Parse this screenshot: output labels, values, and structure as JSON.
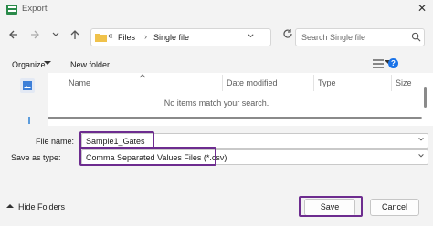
{
  "window": {
    "title": "Export",
    "close_glyph": "✕"
  },
  "nav": {
    "back_icon": "back-arrow-icon",
    "forward_icon": "forward-arrow-icon",
    "recent_icon": "chevron-down-icon",
    "up_icon": "up-arrow-icon"
  },
  "address": {
    "overflow": "«",
    "crumbs": [
      "Files",
      "Single file"
    ],
    "separator": "›"
  },
  "search": {
    "placeholder": "Search Single file"
  },
  "toolbar": {
    "organize_label": "Organize",
    "new_folder_label": "New folder"
  },
  "columns": [
    "Name",
    "Date modified",
    "Type",
    "Size"
  ],
  "file_list": {
    "empty_message": "No items match your search."
  },
  "form": {
    "file_name_label": "File name:",
    "file_name_value": "Sample1_Gates",
    "save_as_type_label": "Save as type:",
    "save_as_type_value": "Comma Separated Values Files (*.csv)"
  },
  "footer": {
    "hide_folders_label": "Hide Folders",
    "save_label": "Save",
    "cancel_label": "Cancel"
  },
  "colors": {
    "highlight": "#6d2c8f",
    "accent": "#1a73e8",
    "folder": "#f0c24b"
  }
}
